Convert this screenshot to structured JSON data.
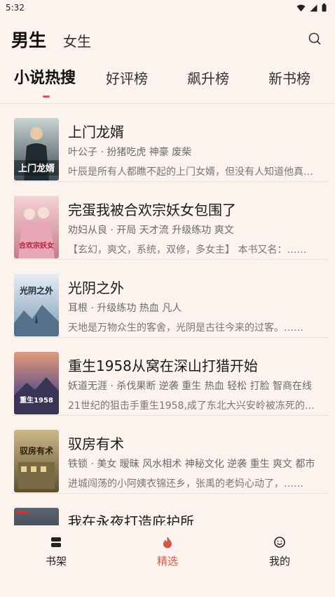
{
  "status": {
    "time": "5:32"
  },
  "gender": {
    "active": "男生",
    "inactive": "女生"
  },
  "tabs": [
    {
      "label": "小说热搜",
      "active": true
    },
    {
      "label": "好评榜",
      "active": false
    },
    {
      "label": "飙升榜",
      "active": false
    },
    {
      "label": "新书榜",
      "active": false
    }
  ],
  "books": [
    {
      "title": "上门龙婿",
      "meta": "叶公子 · 扮猪吃虎 神豪 废柴",
      "desc": "叶辰是所有人都瞧不起的上门女婿，但没有人知道他真实的身份……",
      "cover_text": "上门龙婿"
    },
    {
      "title": "完蛋我被合欢宗妖女包围了",
      "meta": "劝妇从良 · 开局 天才流 升级练功 爽文",
      "desc": "【玄幻，爽文，系统，双修，多女主】 本书又名：……",
      "cover_text": "合欢宗妖女"
    },
    {
      "title": "光阴之外",
      "meta": "耳根 · 升级练功 热血 凡人",
      "desc": "天地是万物众生的客舍，光阴是古往今来的过客。……",
      "cover_text": "光阴之外"
    },
    {
      "title": "重生1958从窝在深山打猎开始",
      "meta": "妖道无涯 · 杀伐果断 逆袭 重生 热血 轻松 打脸 智商在线",
      "desc": "21世纪的狙击手重生1958,成了东北大兴安岭被冻死的……",
      "cover_text": "重生1958"
    },
    {
      "title": "驭房有术",
      "meta": "铁锁 · 美女 暧昧 风水相术 神秘文化 逆袭 重生 爽文 都市",
      "desc": "进城闯荡的小阿姨衣锦还乡，张禹的老妈心动了，……",
      "cover_text": "驭房有术"
    },
    {
      "title": "我在永夜打造庇护所",
      "meta": "",
      "desc": "",
      "cover_text": ""
    }
  ],
  "nav": [
    {
      "label": "书架",
      "icon": "bookshelf-icon",
      "active": false
    },
    {
      "label": "精选",
      "icon": "flame-icon",
      "active": true
    },
    {
      "label": "我的",
      "icon": "smile-icon",
      "active": false
    }
  ],
  "colors": {
    "accent": "#d4584a",
    "background": "#fcf3ef"
  }
}
